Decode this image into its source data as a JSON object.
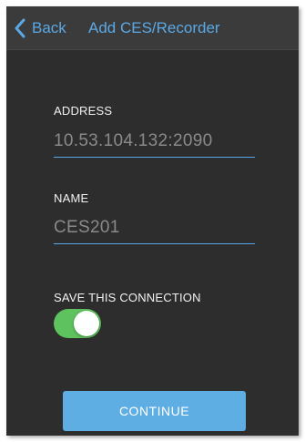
{
  "header": {
    "back_label": "Back",
    "title": "Add CES/Recorder"
  },
  "form": {
    "address": {
      "label": "ADDRESS",
      "value": "10.53.104.132:2090"
    },
    "name": {
      "label": "NAME",
      "value": "CES201"
    },
    "save_connection": {
      "label": "SAVE THIS CONNECTION",
      "enabled": true
    }
  },
  "actions": {
    "continue_label": "CONTINUE"
  },
  "icons": {
    "back": "chevron-left-icon"
  },
  "colors": {
    "accent": "#5aa9e6",
    "toggle_on": "#5ec25e",
    "button": "#5eaee3",
    "background": "#2d2d2d",
    "navbar": "#3b3b3b"
  }
}
